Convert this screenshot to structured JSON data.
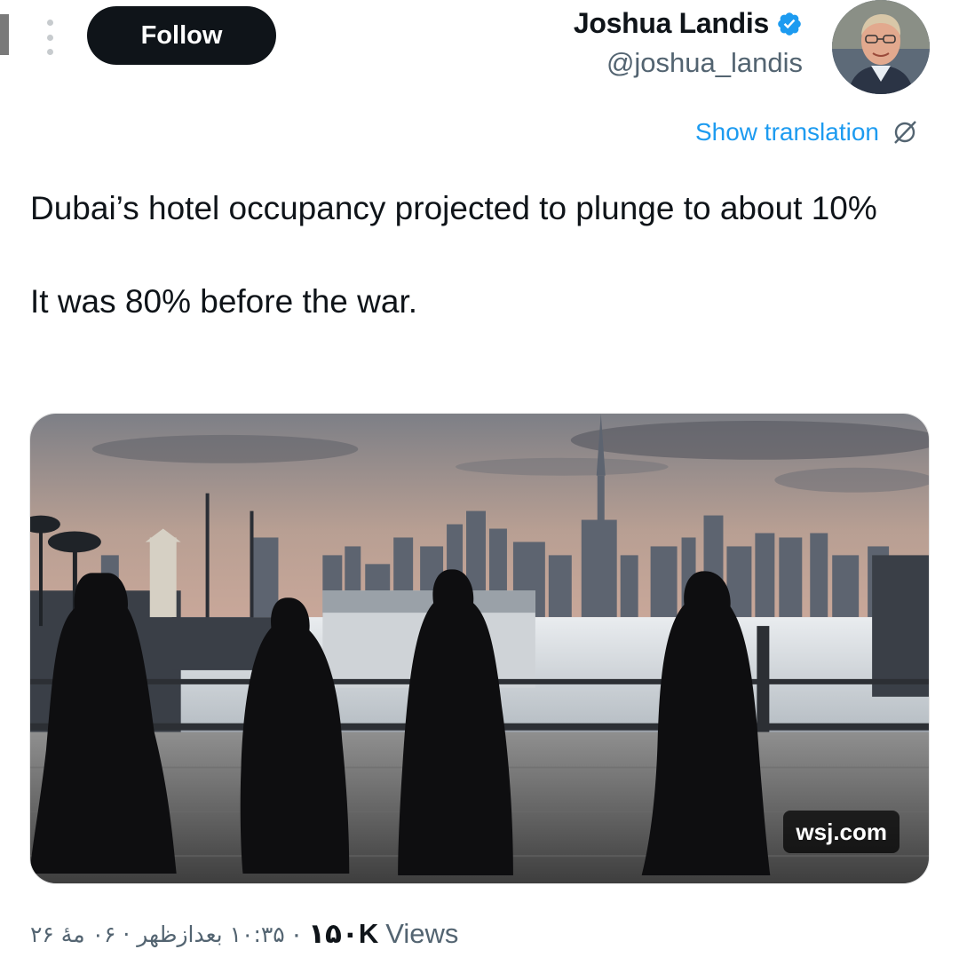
{
  "header": {
    "follow_label": "Follow",
    "author_name": "Joshua Landis",
    "author_handle": "@joshua_landis",
    "verified": true
  },
  "translate": {
    "label": "Show translation"
  },
  "tweet": {
    "paragraphs": [
      "Dubai’s hotel occupancy projected to plunge to about 10%",
      "It was 80% before the war."
    ]
  },
  "media": {
    "source_label": "wsj.com",
    "description_icon": "photo"
  },
  "meta": {
    "date_time": "۱۰:۳۵ بعدازظهر · ۰۶ مهٔ ۲۶",
    "separator": "·",
    "views_count": "۱۵۰K",
    "views_label": "Views"
  },
  "colors": {
    "accent": "#1d9bf0",
    "text_primary": "#0f1419",
    "text_secondary": "#536471",
    "follow_bg": "#0f1419"
  }
}
